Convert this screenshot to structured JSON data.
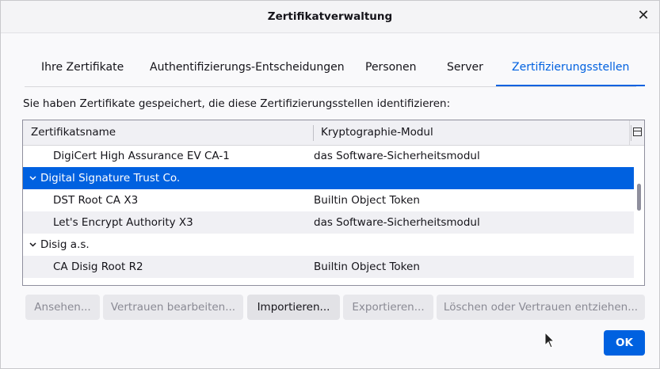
{
  "window": {
    "title": "Zertifikatverwaltung",
    "close_glyph": "✕"
  },
  "tabs": [
    {
      "label": "Ihre Zertifikate"
    },
    {
      "label": "Authentifizierungs-Entscheidungen"
    },
    {
      "label": "Personen"
    },
    {
      "label": "Server"
    },
    {
      "label": "Zertifizierungsstellen",
      "active": true
    }
  ],
  "description": "Sie haben Zertifikate gespeichert, die diese Zertifizierungsstellen identifizieren:",
  "table": {
    "columns": [
      "Zertifikatsname",
      "Kryptographie-Modul"
    ],
    "rows": [
      {
        "name": "DigiCert High Assurance EV CA-1",
        "module": "das Software-Sicherheitsmodul",
        "type": "child"
      },
      {
        "name": "Digital Signature Trust Co.",
        "module": "",
        "type": "group",
        "selected": true
      },
      {
        "name": "DST Root CA X3",
        "module": "Builtin Object Token",
        "type": "child"
      },
      {
        "name": "Let's Encrypt Authority X3",
        "module": "das Software-Sicherheitsmodul",
        "type": "child"
      },
      {
        "name": "Disig a.s.",
        "module": "",
        "type": "group"
      },
      {
        "name": "CA Disig Root R2",
        "module": "Builtin Object Token",
        "type": "child"
      }
    ]
  },
  "buttons": {
    "view": "Ansehen...",
    "edit_trust": "Vertrauen bearbeiten...",
    "import": "Importieren...",
    "export": "Exportieren...",
    "delete": "Löschen oder Vertrauen entziehen...",
    "ok": "OK"
  },
  "colors": {
    "accent": "#0061e0"
  },
  "icons": {
    "close": "close-icon",
    "expand": "chevron-down-icon",
    "column_picker": "column-picker-icon",
    "cursor": "mouse-cursor-icon"
  }
}
